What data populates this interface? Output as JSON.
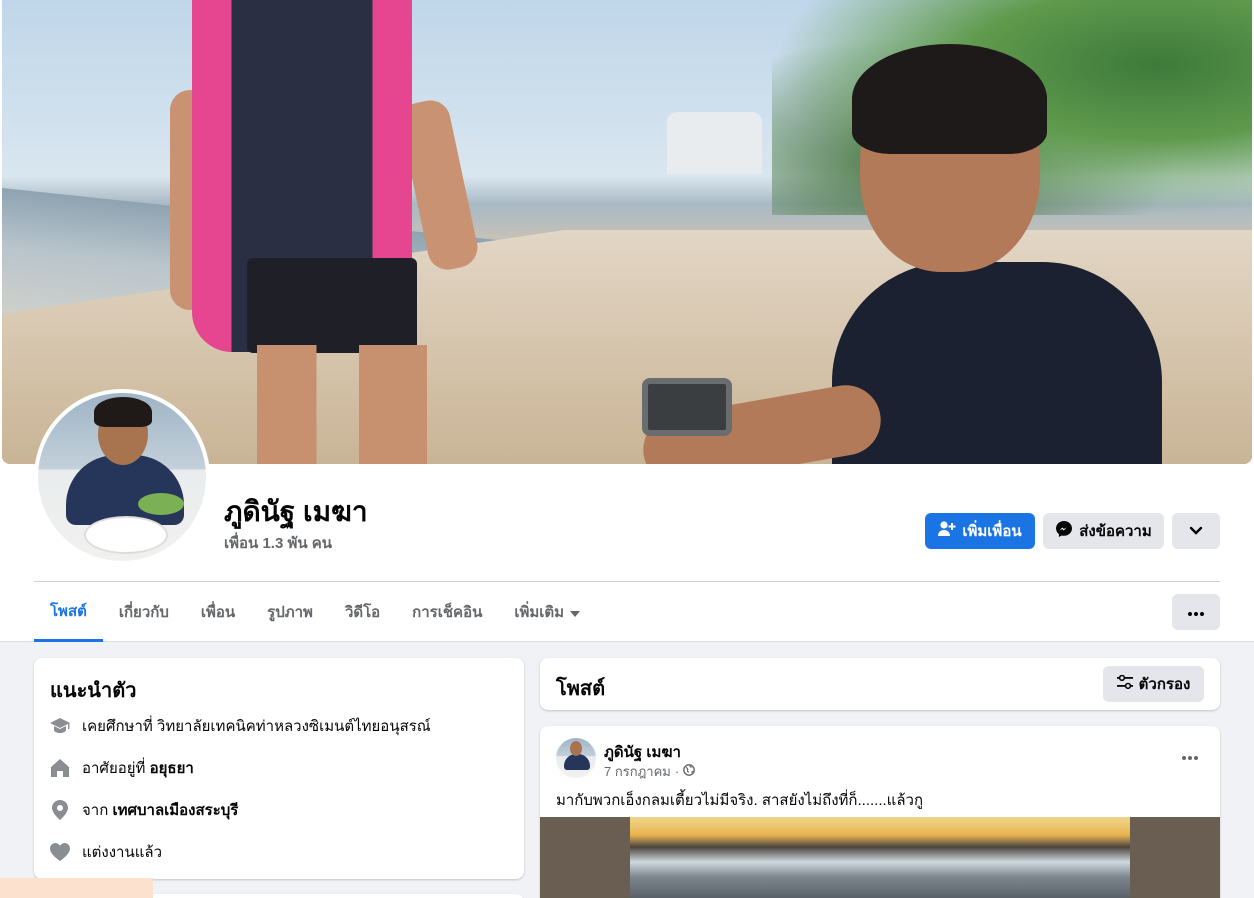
{
  "profile": {
    "name": "ภูดินัฐ เมฆา",
    "friends": "เพื่อน 1.3 พัน คน"
  },
  "actions": {
    "add_friend": "เพิ่มเพื่อน",
    "message": "ส่งข้อความ"
  },
  "tabs": [
    {
      "label": "โพสต์",
      "active": true
    },
    {
      "label": "เกี่ยวกับ"
    },
    {
      "label": "เพื่อน"
    },
    {
      "label": "รูปภาพ"
    },
    {
      "label": "วิดีโอ"
    },
    {
      "label": "การเช็คอิน"
    },
    {
      "label": "เพิ่มเติม"
    }
  ],
  "intro": {
    "title": "แนะนำตัว",
    "rows": [
      {
        "icon": "graduation-cap-icon",
        "prefix": "เคยศึกษาที่ ",
        "value": "วิทยาลัยเทคนิคท่าหลวงซิเมนต์ไทยอนุสรณ์",
        "bold": false
      },
      {
        "icon": "home-icon",
        "prefix": "อาศัยอยู่ที่ ",
        "value": "อยุธยา",
        "bold": true
      },
      {
        "icon": "location-pin-icon",
        "prefix": "จาก ",
        "value": "เทศบาลเมืองสระบุรี",
        "bold": true
      },
      {
        "icon": "heart-icon",
        "prefix": "แต่งงานแล้ว",
        "value": "",
        "bold": false
      }
    ]
  },
  "posts": {
    "title": "โพสต์",
    "filter_label": "ตัวกรอง",
    "items": [
      {
        "author": "ภูดินัฐ เมฆา",
        "date": "7 กรกฎาคม",
        "privacy_icon": "globe-icon",
        "text": "มากับพวกเอ็งกลมเตี้ยวไม่มีจริง.   สาสยังไม่ถึงที่ก็.......แล้วกู"
      }
    ]
  },
  "colors": {
    "accent": "#1b74e4",
    "page_bg": "#f0f2f5",
    "button_gray": "#e4e6eb",
    "secondary_text": "#65676b"
  }
}
